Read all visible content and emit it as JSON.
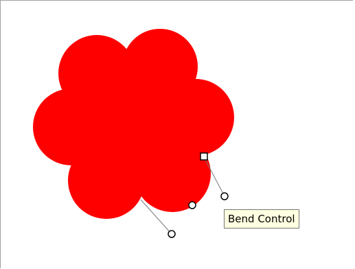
{
  "shape": {
    "name": "cloud",
    "fill_color": "#ff0000"
  },
  "tooltip": {
    "text": "Bend Control"
  },
  "colors": {
    "canvas_border": "#a0a0a0",
    "handle_stroke": "#000000",
    "handle_fill": "#ffffff",
    "tooltip_bg": "#ffffe1"
  }
}
